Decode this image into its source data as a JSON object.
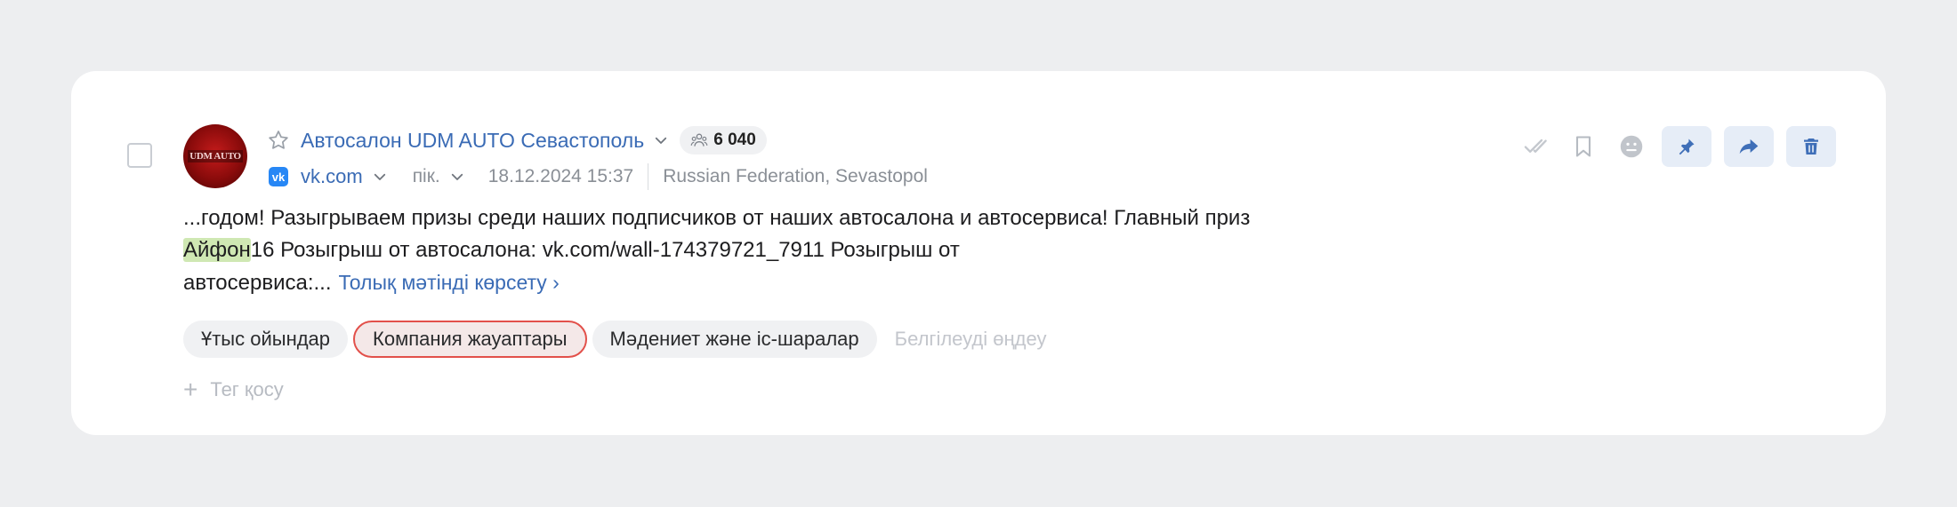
{
  "post": {
    "author": "Автосалон UDM AUTO Севастополь",
    "avatar_text": "UDM AUTO",
    "audience": "6 040",
    "source": "vk.com",
    "sentiment": "пік.",
    "datetime": "18.12.2024 15:37",
    "location": "Russian Federation, Sevastopol",
    "text_line1": "...годом! Разыгрываем призы среди наших подписчиков от наших автосалона и автосервиса! Главный приз",
    "text_highlight": "Айфон",
    "text_line2_rest": "16 Розыгрыш от автосалона: vk.com/wall-174379721_7911 Розыгрыш от",
    "text_line3": "автосервиса:...",
    "more_link": "Толық мәтінді көрсету ›"
  },
  "tags": [
    {
      "label": "Ұтыс ойындар",
      "active": false
    },
    {
      "label": "Компания жауаптары",
      "active": true
    },
    {
      "label": "Мәдениет және іс-шаралар",
      "active": false
    }
  ],
  "tag_edit": "Белгілеуді өңдеу",
  "add_tag": {
    "plus": "+",
    "label": "Тег қосу"
  },
  "colors": {
    "link": "#3a6bb5",
    "highlight": "#cfe8b3",
    "active_tag_border": "#e2504a",
    "action_bg": "#e6edf7"
  },
  "icons": [
    "star-icon",
    "chevron-down-icon",
    "audience-icon",
    "vk-icon",
    "check-icon",
    "bookmark-icon",
    "neutral-face-icon",
    "pin-icon",
    "share-icon",
    "trash-icon"
  ]
}
